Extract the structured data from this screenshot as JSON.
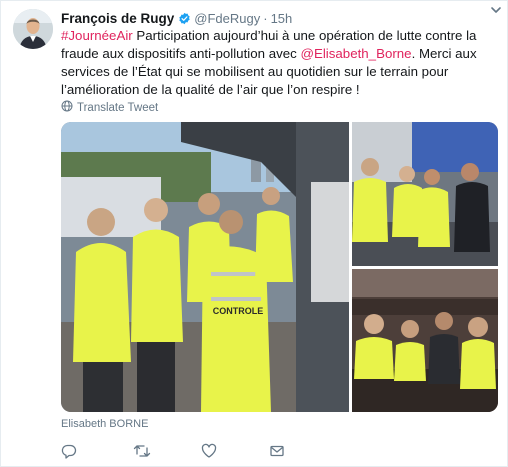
{
  "tweet": {
    "author_name": "François de Rugy",
    "handle": "@FdeRugy",
    "separator": "·",
    "time": "15h",
    "hashtag": "#JournéeAir",
    "text_part1": " Participation aujourd’hui à une opération de lutte contre la fraude aux dispositifs anti-pollution avec ",
    "mention": "@Elisabeth_Borne",
    "text_part2": ". Merci aux services de l’État qui se mobilisent au quotidien sur le terrain pour l’amélioration de la qualité de l’air que l’on respire !",
    "translate_label": "Translate Tweet",
    "media_caption": "Elisabeth BORNE",
    "vest_text": "CONTROLE"
  },
  "colors": {
    "accent": "#e0245e",
    "muted": "#657786",
    "verified": "#1da1f2",
    "hi_vis": "#e8f34a"
  },
  "icons": {
    "verified": "verified-badge-icon",
    "caret": "chevron-down-icon",
    "translate": "globe-icon",
    "reply": "reply-icon",
    "retweet": "retweet-icon",
    "like": "heart-icon",
    "message": "envelope-icon"
  }
}
